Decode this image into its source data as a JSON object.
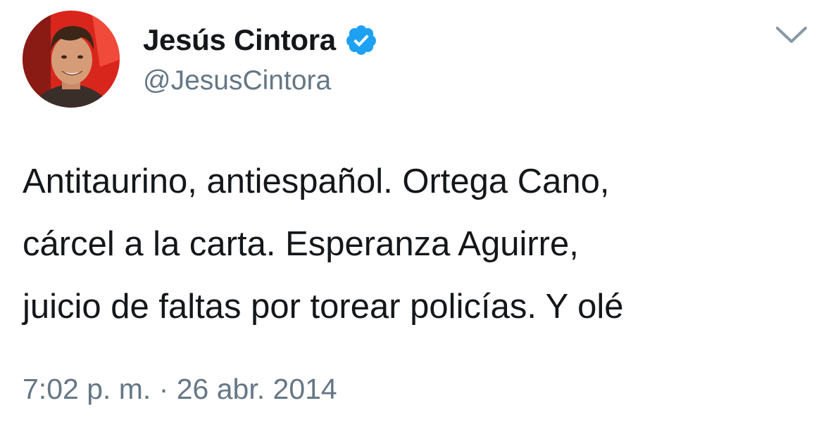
{
  "tweet": {
    "author": {
      "display_name": "Jesús Cintora",
      "handle": "@JesusCintora",
      "verified": true,
      "avatar_icon": "profile-photo"
    },
    "text_lines": [
      "Antitaurino, antiespañol. Ortega Cano,",
      "cárcel a la carta. Esperanza Aguirre,",
      "juicio de faltas por torear policías. Y olé"
    ],
    "timestamp": "7:02 p. m. · 26 abr. 2014",
    "menu_icon": "chevron-down-icon"
  },
  "colors": {
    "verified_blue": "#1da1f2",
    "secondary_text": "#657786",
    "primary_text": "#14171a",
    "avatar_background": "#d9261c"
  }
}
